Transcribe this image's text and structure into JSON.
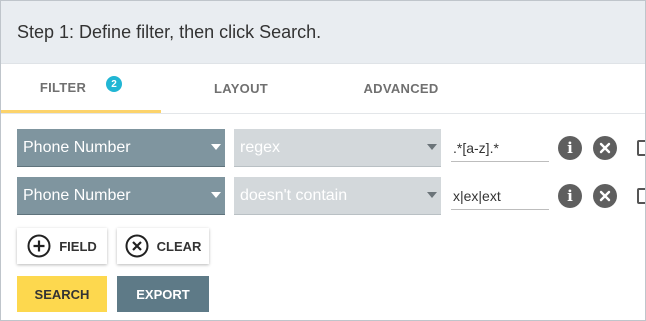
{
  "header": {
    "title": "Step 1: Define filter, then click Search."
  },
  "tabs": [
    {
      "label": "FILTER",
      "badge": "2",
      "active": true
    },
    {
      "label": "LAYOUT"
    },
    {
      "label": "ADVANCED"
    }
  ],
  "filters": [
    {
      "field": "Phone Number",
      "operator": "regex",
      "value": ".*[a-z].*"
    },
    {
      "field": "Phone Number",
      "operator": "doesn't contain",
      "value": "x|ex|ext"
    }
  ],
  "buttons": {
    "add_field": "FIELD",
    "clear": "CLEAR",
    "search": "SEARCH",
    "export": "EXPORT"
  },
  "icons": {
    "info": "i",
    "remove": "close-circle-icon",
    "add": "plus-circle-icon",
    "clear": "x-circle-icon"
  },
  "colors": {
    "accent_yellow": "#fdd84e",
    "tab_underline": "#fcd36b",
    "badge": "#21b6d4",
    "field_select": "#7f959f",
    "operator_select": "#d3d8db",
    "export_button": "#5e7a87"
  }
}
